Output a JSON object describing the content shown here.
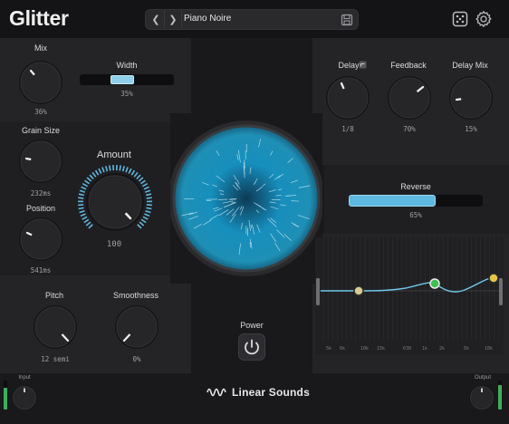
{
  "header": {
    "app_title": "Glitter",
    "preset_name": "Piano Noire"
  },
  "mix": {
    "label": "Mix",
    "value": "36%"
  },
  "width": {
    "label": "Width",
    "value": "35%",
    "level": 0.35
  },
  "grain_size": {
    "label": "Grain Size",
    "value": "232ms"
  },
  "position": {
    "label": "Position",
    "value": "541ms"
  },
  "amount": {
    "label": "Amount",
    "value": "100"
  },
  "pitch": {
    "label": "Pitch",
    "value": "12 semi"
  },
  "smoothness": {
    "label": "Smoothness",
    "value": "0%"
  },
  "power": {
    "label": "Power"
  },
  "delay": {
    "label": "Delay",
    "value": "1/8"
  },
  "feedback": {
    "label": "Feedback",
    "value": "70%"
  },
  "delay_mix": {
    "label": "Delay Mix",
    "value": "15%"
  },
  "reverse": {
    "label": "Reverse",
    "value": "65%",
    "level": 0.65
  },
  "eq": {
    "freq_labels": [
      "5k",
      "6k",
      "10k",
      "15k",
      "630",
      "1k",
      "2k",
      "5k",
      "10k"
    ]
  },
  "input": {
    "label": "Input",
    "level": 0.75
  },
  "output": {
    "label": "Output",
    "level": 0.85
  },
  "brand": {
    "name": "Linear Sounds"
  },
  "colors": {
    "accent": "#5fb8df",
    "panel": "#242427",
    "background": "#19191b"
  }
}
